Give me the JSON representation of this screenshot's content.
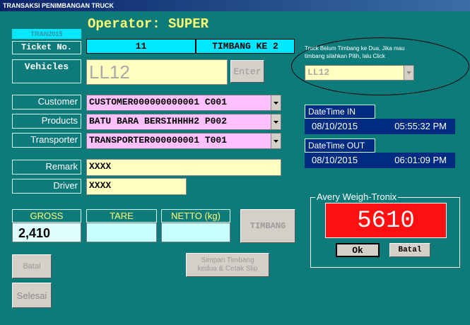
{
  "window": {
    "title": "TRANSAKSI PENIMBANGAN TRUCK"
  },
  "header": {
    "code": "TRAN2015",
    "operator": "Operator: SUPER"
  },
  "ticket": {
    "label": "Ticket No.",
    "number": "11",
    "timbang": "TIMBANG KE 2"
  },
  "vehicles": {
    "label": "Vehicles",
    "value": "LL12",
    "enter_label": "Enter"
  },
  "hint": {
    "text": "Truck Belum Timbang ke Dua, Jika mau timbang silahkan Pilih, lalu Click",
    "selected": "LL12"
  },
  "customer": {
    "label": "Customer",
    "value": "CUSTOMER000000000001 C001"
  },
  "products": {
    "label": "Products",
    "value": "BATU BARA BERSIHHHH2 P002"
  },
  "transporter": {
    "label": "Transporter",
    "value": "TRANSPORTER000000001 T001"
  },
  "remark": {
    "label": "Remark",
    "value": "XXXX"
  },
  "driver": {
    "label": "Driver",
    "value": "XXXX"
  },
  "datetime_in": {
    "label": "DateTime IN",
    "date": "08/10/2015",
    "time": "05:55:32 PM"
  },
  "datetime_out": {
    "label": "DateTime OUT",
    "date": "08/10/2015",
    "time": "06:01:09 PM"
  },
  "weights": {
    "gross_label": "GROSS",
    "gross_value": "2,410",
    "tare_label": "TARE",
    "tare_value": "",
    "netto_label": "NETTO (kg)",
    "netto_value": ""
  },
  "timbang_button": "TIMBANG",
  "scale": {
    "title": "Avery Weigh-Tronix",
    "reading": "5610",
    "ok_label": "Ok",
    "cancel_label": "Batal"
  },
  "actions": {
    "batal_label": "Batal",
    "simpan_label": "Simpan Timbang kedua & Cetak Slip",
    "selesai_label": "Selesai"
  }
}
